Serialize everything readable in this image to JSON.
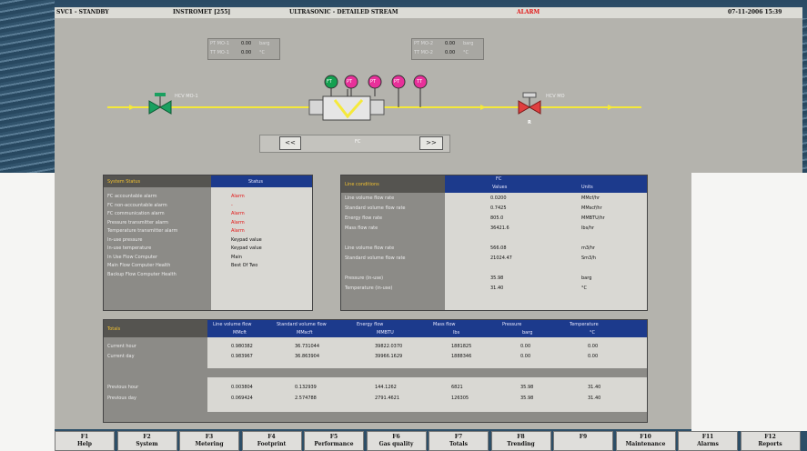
{
  "titlebar": {
    "mode": "SVC1 - STANDBY",
    "device": "INSTROMET [255]",
    "screen": "ULTRASONIC - DETAILED STREAM",
    "alarm": "ALARM",
    "datetime": "07-11-2006 15:39"
  },
  "colors": {
    "alarm": "#e31515",
    "header_blue": "#1c3a8c",
    "accent_yellow": "#f0c030",
    "pipe": "#f5e93a",
    "valve_green": "#1aa060",
    "valve_red": "#e04040",
    "tag_pink": "#e8309a",
    "tag_green": "#14a050"
  },
  "pt_left": {
    "rows": [
      {
        "tag": "PT MO-1",
        "value": "0.00",
        "unit": "barg"
      },
      {
        "tag": "TT MO-1",
        "value": "0.00",
        "unit": "°C"
      }
    ]
  },
  "pt_right": {
    "rows": [
      {
        "tag": "PT MO-2",
        "value": "0.00",
        "unit": "barg"
      },
      {
        "tag": "TT MO-2",
        "value": "0.00",
        "unit": "°C"
      }
    ]
  },
  "valves": {
    "left_label": "HCV MO-1",
    "right_label": "HCV MO",
    "right_sub": "R"
  },
  "instrument_tags": [
    "FT",
    "PT",
    "PT",
    "PT",
    "TT"
  ],
  "nav": {
    "prev": "<<",
    "next": ">>",
    "label": "FC"
  },
  "status": {
    "header": "System Status",
    "col": "Status",
    "rows": [
      {
        "name": "FC accountable alarm",
        "value": "Alarm",
        "alarm": true
      },
      {
        "name": "FC non-accountable alarm",
        "value": "-",
        "alarm": true
      },
      {
        "name": "FC communication alarm",
        "value": "Alarm",
        "alarm": true
      },
      {
        "name": "Pressure transmitter alarm",
        "value": "Alarm",
        "alarm": true
      },
      {
        "name": "Temperature transmitter alarm",
        "value": "Alarm",
        "alarm": true
      },
      {
        "name": "In-use pressure",
        "value": "Keypad value",
        "alarm": false
      },
      {
        "name": "In-use temperature",
        "value": "Keypad value",
        "alarm": false
      },
      {
        "name": "In Use Flow Computer",
        "value": "Main",
        "alarm": false
      },
      {
        "name": "Main Flow Computer Health",
        "value": "Best Of Two",
        "alarm": false
      },
      {
        "name": "Backup Flow Computer Health",
        "value": "",
        "alarm": false
      }
    ]
  },
  "line": {
    "header": "Line conditions",
    "col_group": "FC",
    "col_values": "Values",
    "col_units": "Units",
    "rows": [
      {
        "name": "Line volume flow rate",
        "value": "0.0200",
        "unit": "MMcf/hr"
      },
      {
        "name": "Standard volume flow rate",
        "value": "0.7425",
        "unit": "MMscf/hr"
      },
      {
        "name": "Energy flow rate",
        "value": "805.0",
        "unit": "MMBTU/hr"
      },
      {
        "name": "Mass flow rate",
        "value": "36421.6",
        "unit": "lbs/hr"
      },
      {
        "name": "",
        "value": "",
        "unit": ""
      },
      {
        "name": "Line volume flow rate",
        "value": "566.08",
        "unit": "m3/hr"
      },
      {
        "name": "Standard volume flow rate",
        "value": "21024.47",
        "unit": "Sm3/h"
      },
      {
        "name": "",
        "value": "",
        "unit": ""
      },
      {
        "name": "Pressure (in-use)",
        "value": "35.98",
        "unit": "barg"
      },
      {
        "name": "Temperature (in-use)",
        "value": "31.40",
        "unit": "°C"
      }
    ]
  },
  "totals": {
    "header": "Totals",
    "cols": [
      {
        "label": "Line volume flow",
        "unit": "MMcft"
      },
      {
        "label": "Standard volume flow",
        "unit": "MMscft"
      },
      {
        "label": "Energy flow",
        "unit": "MMBTU"
      },
      {
        "label": "Mass flow",
        "unit": "lbs"
      },
      {
        "label": "Pressure",
        "unit": "barg"
      },
      {
        "label": "Temperature",
        "unit": "°C"
      }
    ],
    "rows": [
      {
        "name": "Current hour",
        "values": [
          "0.980382",
          "36.731044",
          "39822.0370",
          "1881825",
          "0.00",
          "0.00"
        ]
      },
      {
        "name": "Current day",
        "values": [
          "0.983967",
          "36.863904",
          "39966.1629",
          "1888346",
          "0.00",
          "0.00"
        ]
      },
      {
        "name": "Previous hour",
        "values": [
          "0.003804",
          "0.132939",
          "144.1262",
          "6821",
          "35.98",
          "31.40"
        ]
      },
      {
        "name": "Previous day",
        "values": [
          "0.069424",
          "2.574788",
          "2791.4621",
          "126305",
          "35.98",
          "31.40"
        ]
      }
    ]
  },
  "fkeys": [
    {
      "key": "F1",
      "label": "Help"
    },
    {
      "key": "F2",
      "label": "System"
    },
    {
      "key": "F3",
      "label": "Metering"
    },
    {
      "key": "F4",
      "label": "Footprint"
    },
    {
      "key": "F5",
      "label": "Performance"
    },
    {
      "key": "F6",
      "label": "Gas quality"
    },
    {
      "key": "F7",
      "label": "Totals"
    },
    {
      "key": "F8",
      "label": "Trending"
    },
    {
      "key": "F9",
      "label": ""
    },
    {
      "key": "F10",
      "label": "Maintenance"
    },
    {
      "key": "F11",
      "label": "Alarms"
    },
    {
      "key": "F12",
      "label": "Reports"
    }
  ]
}
